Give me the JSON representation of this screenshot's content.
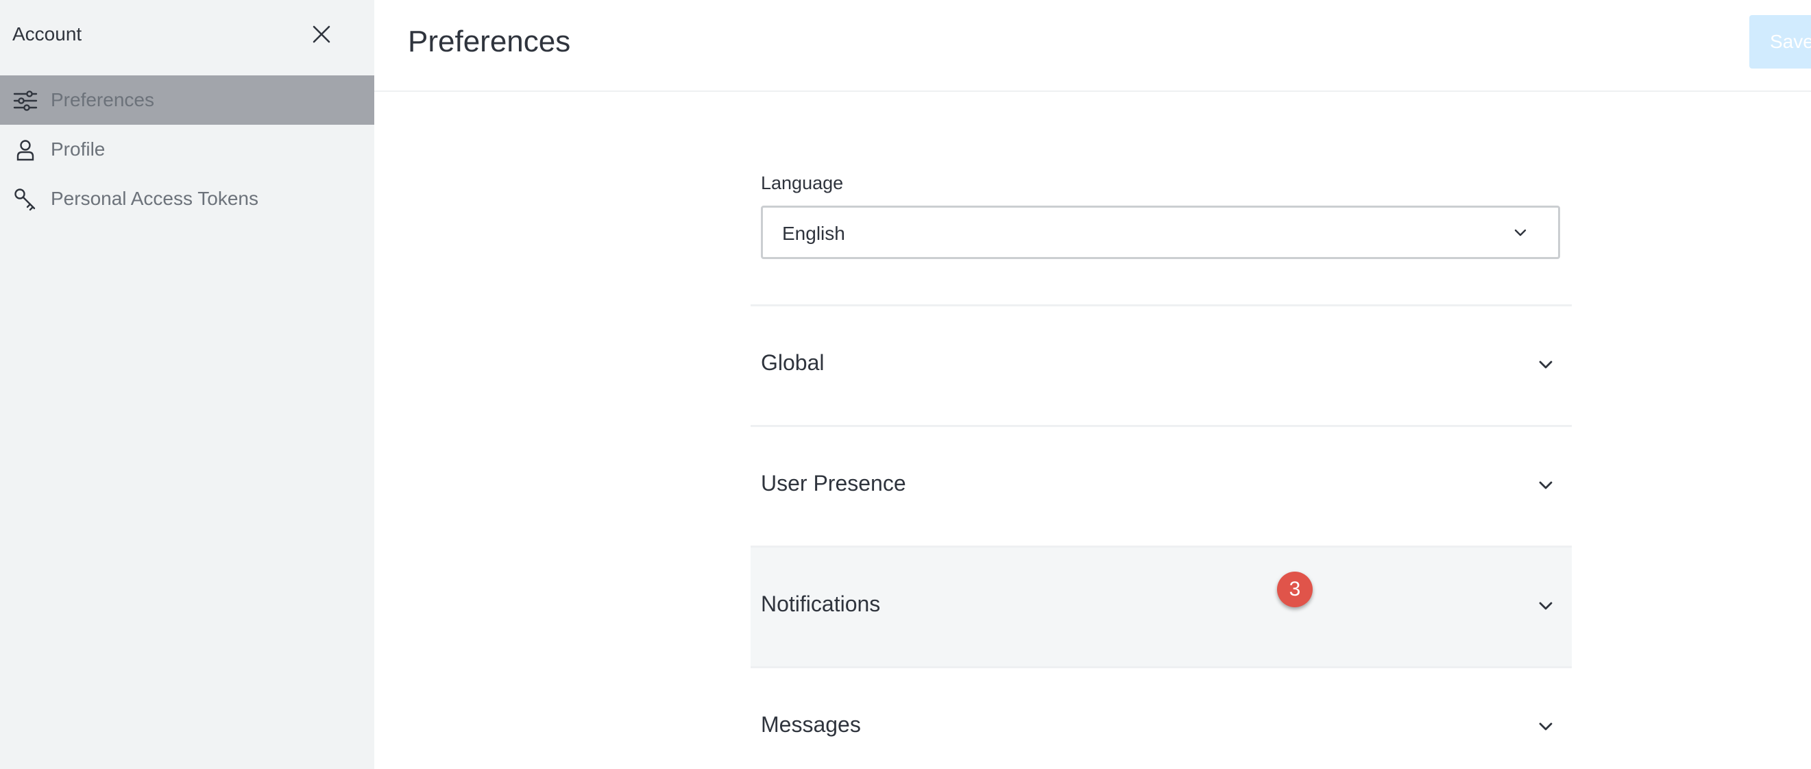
{
  "sidebar": {
    "title": "Account",
    "items": [
      {
        "label": "Preferences",
        "icon": "sliders-icon",
        "active": true
      },
      {
        "label": "Profile",
        "icon": "user-icon",
        "active": false
      },
      {
        "label": "Personal Access Tokens",
        "icon": "key-icon",
        "active": false
      }
    ]
  },
  "header": {
    "title": "Preferences",
    "save_label": "Save"
  },
  "language": {
    "label": "Language",
    "value": "English"
  },
  "sections": [
    {
      "title": "Global"
    },
    {
      "title": "User Presence"
    },
    {
      "title": "Notifications",
      "badge": "3"
    },
    {
      "title": "Messages"
    }
  ],
  "colors": {
    "active_nav_bg": "#a2a5ab",
    "badge": "#e0544a",
    "save_button_disabled": "#d1ebfe"
  }
}
